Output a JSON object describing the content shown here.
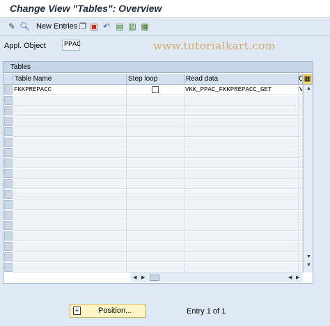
{
  "window": {
    "title": "Change View \"Tables\": Overview"
  },
  "toolbar": {
    "new_entries_label": "New Entries",
    "watermark": "www.tutorialkart.com"
  },
  "appl_object": {
    "label": "Appl. Object",
    "value": "PPAC"
  },
  "table": {
    "title": "Tables",
    "columns": [
      "Table Name",
      "Step loop",
      "Read data",
      "C"
    ],
    "rows": [
      {
        "table_name": "FKKPREPACC",
        "step_loop": false,
        "read_data": "VKK_PPAC_FKKPREPACC_GET",
        "c": "V"
      }
    ]
  },
  "footer": {
    "position_label": "Position...",
    "entry_text": "Entry 1 of 1"
  }
}
